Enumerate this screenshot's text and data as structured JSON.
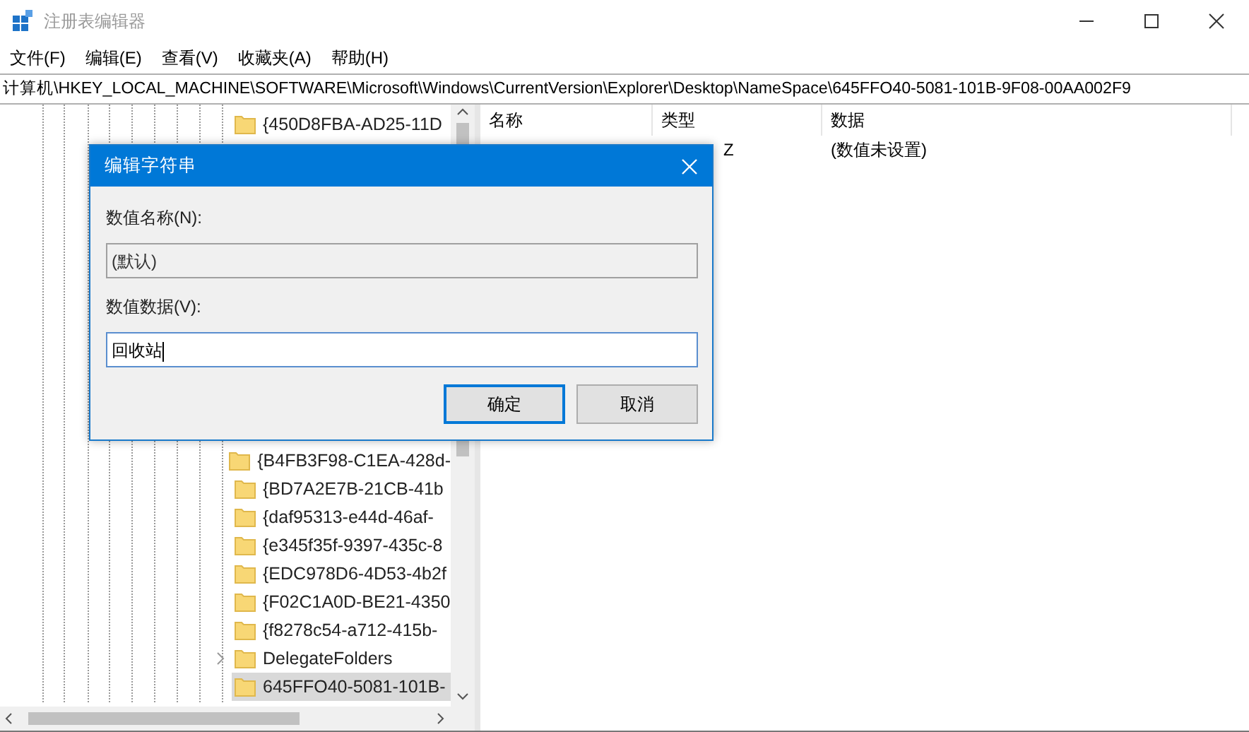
{
  "window": {
    "title": "注册表编辑器"
  },
  "menu": [
    "文件(F)",
    "编辑(E)",
    "查看(V)",
    "收藏夹(A)",
    "帮助(H)"
  ],
  "address": "计算机\\HKEY_LOCAL_MACHINE\\SOFTWARE\\Microsoft\\Windows\\CurrentVersion\\Explorer\\Desktop\\NameSpace\\645FFO40-5081-101B-9F08-00AA002F9",
  "tree": {
    "items": [
      {
        "label": "{450D8FBA-AD25-11D",
        "expandable": false,
        "selected": false
      },
      {
        "label": "{B4FB3F98-C1EA-428d-",
        "expandable": false,
        "selected": false
      },
      {
        "label": "{BD7A2E7B-21CB-41b",
        "expandable": false,
        "selected": false
      },
      {
        "label": "{daf95313-e44d-46af-",
        "expandable": false,
        "selected": false
      },
      {
        "label": "{e345f35f-9397-435c-8",
        "expandable": false,
        "selected": false
      },
      {
        "label": "{EDC978D6-4D53-4b2f",
        "expandable": false,
        "selected": false
      },
      {
        "label": "{F02C1A0D-BE21-4350",
        "expandable": false,
        "selected": false
      },
      {
        "label": "{f8278c54-a712-415b-",
        "expandable": false,
        "selected": false
      },
      {
        "label": "DelegateFolders",
        "expandable": true,
        "selected": false
      },
      {
        "label": "645FFO40-5081-101B-",
        "expandable": false,
        "selected": true
      }
    ]
  },
  "table": {
    "columns": [
      "名称",
      "类型",
      "数据"
    ],
    "rows": [
      {
        "type": "Z",
        "data": "(数值未设置)"
      }
    ]
  },
  "dialog": {
    "title": "编辑字符串",
    "name_label": "数值名称(N):",
    "name_value": "(默认)",
    "data_label": "数值数据(V):",
    "data_value": "回收站",
    "buttons": [
      {
        "label": "确定",
        "default": true
      },
      {
        "label": "取消",
        "default": false
      }
    ]
  }
}
